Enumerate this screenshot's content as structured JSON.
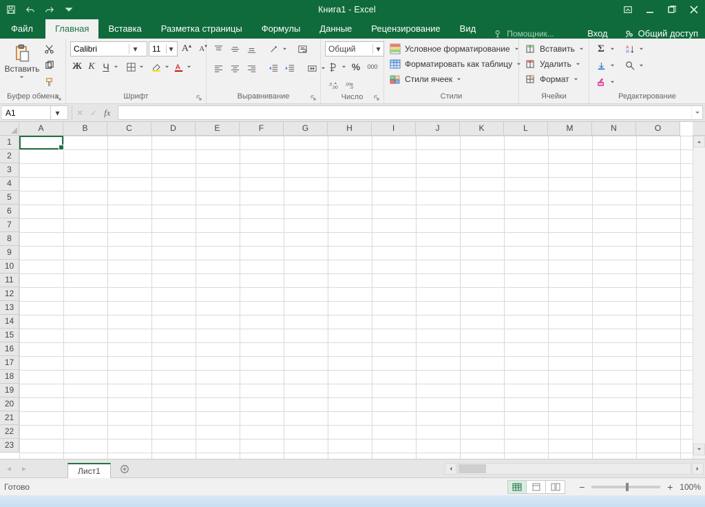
{
  "title": "Книга1 - Excel",
  "tabs": {
    "file": "Файл",
    "home": "Главная",
    "insert": "Вставка",
    "pagelayout": "Разметка страницы",
    "formulas": "Формулы",
    "data": "Данные",
    "review": "Рецензирование",
    "view": "Вид",
    "tellme_placeholder": "Помощник...",
    "login": "Вход",
    "share": "Общий доступ"
  },
  "ribbon": {
    "clipboard": {
      "paste": "Вставить",
      "label": "Буфер обмена"
    },
    "font": {
      "label": "Шрифт",
      "name": "Calibri",
      "size": "11",
      "increase": "A",
      "decrease": "A",
      "bold": "Ж",
      "italic": "К",
      "underline": "Ч"
    },
    "alignment": {
      "label": "Выравнивание"
    },
    "number": {
      "label": "Число",
      "format": "Общий",
      "percent": "%",
      "thousands": "000"
    },
    "styles": {
      "label": "Стили",
      "cond": "Условное форматирование",
      "table": "Форматировать как таблицу",
      "cell": "Стили ячеек"
    },
    "cells": {
      "label": "Ячейки",
      "insert": "Вставить",
      "delete": "Удалить",
      "format": "Формат"
    },
    "editing": {
      "label": "Редактирование"
    }
  },
  "formulaBar": {
    "nameBox": "A1",
    "fx": "fx"
  },
  "grid": {
    "columns": [
      "A",
      "B",
      "C",
      "D",
      "E",
      "F",
      "G",
      "H",
      "I",
      "J",
      "K",
      "L",
      "M",
      "N",
      "O"
    ],
    "rows": [
      "1",
      "2",
      "3",
      "4",
      "5",
      "6",
      "7",
      "8",
      "9",
      "10",
      "11",
      "12",
      "13",
      "14",
      "15",
      "16",
      "17",
      "18",
      "19",
      "20",
      "21",
      "22",
      "23"
    ]
  },
  "sheet": {
    "tab1": "Лист1"
  },
  "status": {
    "ready": "Готово",
    "zoom": "100%"
  }
}
